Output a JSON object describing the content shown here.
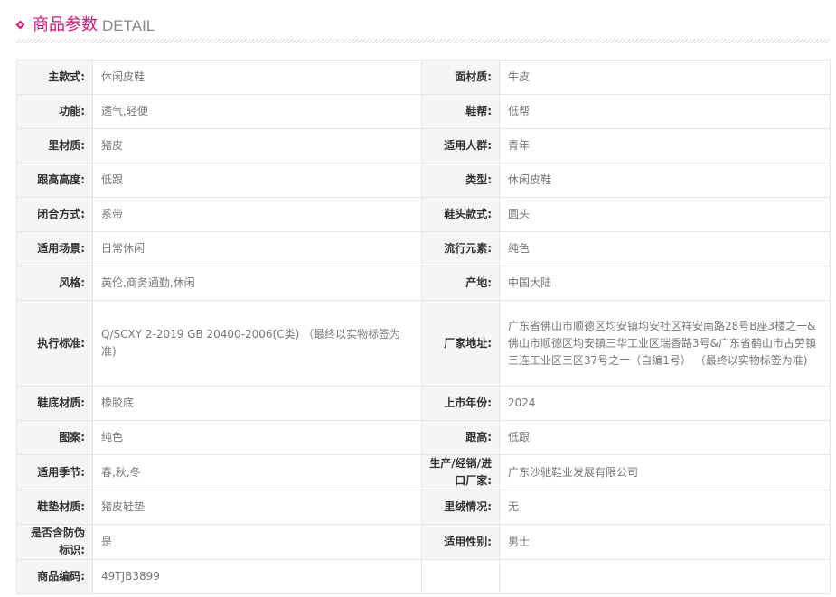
{
  "header": {
    "title_cn": "商品参数",
    "title_en": "DETAIL"
  },
  "params": [
    {
      "left": {
        "label": "主款式:",
        "value": "休闲皮鞋"
      },
      "right": {
        "label": "面材质:",
        "value": "牛皮"
      }
    },
    {
      "left": {
        "label": "功能:",
        "value": "透气,轻便"
      },
      "right": {
        "label": "鞋帮:",
        "value": "低帮"
      }
    },
    {
      "left": {
        "label": "里材质:",
        "value": "猪皮"
      },
      "right": {
        "label": "适用人群:",
        "value": "青年"
      }
    },
    {
      "left": {
        "label": "跟高高度:",
        "value": "低跟"
      },
      "right": {
        "label": "类型:",
        "value": "休闲皮鞋"
      }
    },
    {
      "left": {
        "label": "闭合方式:",
        "value": "系带"
      },
      "right": {
        "label": "鞋头款式:",
        "value": "圆头"
      }
    },
    {
      "left": {
        "label": "适用场景:",
        "value": "日常休闲"
      },
      "right": {
        "label": "流行元素:",
        "value": "纯色"
      }
    },
    {
      "left": {
        "label": "风格:",
        "value": "英伦,商务通勤,休闲"
      },
      "right": {
        "label": "产地:",
        "value": "中国大陆"
      }
    },
    {
      "left": {
        "label": "执行标准:",
        "value": "Q/SCXY 2-2019 GB 20400-2006(C类) （最终以实物标签为准)"
      },
      "right": {
        "label": "厂家地址:",
        "value": "广东省佛山市顺德区均安镇均安社区祥安南路28号B座3楼之一&佛山市顺德区均安镇三华工业区瑞香路3号&广东省鹤山市古劳镇三连工业区三区37号之一（自编1号） （最终以实物标签为准)"
      }
    },
    {
      "left": {
        "label": "鞋底材质:",
        "value": "橡胶底"
      },
      "right": {
        "label": "上市年份:",
        "value": "2024"
      }
    },
    {
      "left": {
        "label": "图案:",
        "value": "纯色"
      },
      "right": {
        "label": "跟高:",
        "value": "低跟"
      }
    },
    {
      "left": {
        "label": "适用季节:",
        "value": "春,秋,冬"
      },
      "right": {
        "label": "生产/经销/进口厂家:",
        "value": "广东沙驰鞋业发展有限公司"
      }
    },
    {
      "left": {
        "label": "鞋垫材质:",
        "value": "猪皮鞋垫"
      },
      "right": {
        "label": "里绒情况:",
        "value": "无"
      }
    },
    {
      "left": {
        "label": "是否含防伪标识:",
        "value": "是"
      },
      "right": {
        "label": "适用性别:",
        "value": "男士"
      }
    },
    {
      "left": {
        "label": "商品编码:",
        "value": "49TJB3899"
      },
      "right": {
        "label": "",
        "value": ""
      }
    }
  ]
}
